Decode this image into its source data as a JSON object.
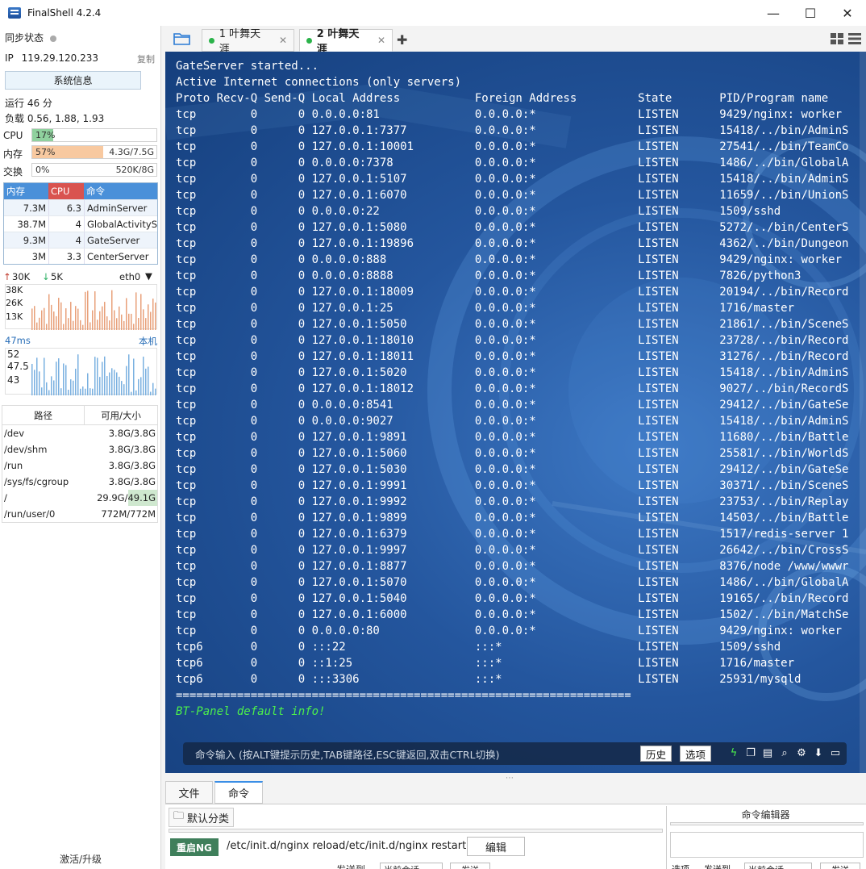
{
  "window": {
    "title": "FinalShell 4.2.4",
    "minimize": "—",
    "maximize": "☐",
    "close": "✕"
  },
  "sidebar": {
    "sync_label": "同步状态",
    "ip_label": "IP",
    "ip": "119.29.120.233",
    "copy": "复制",
    "sysinfo_btn": "系统信息",
    "uptime": "运行 46 分",
    "load": "负载 0.56, 1.88, 1.93",
    "cpu": {
      "label": "CPU",
      "value": "17%",
      "percent": 17
    },
    "mem": {
      "label": "内存",
      "value": "57%",
      "detail": "4.3G/7.5G",
      "percent": 57
    },
    "swap": {
      "label": "交换",
      "value": "0%",
      "detail": "520K/8G",
      "percent": 0
    },
    "proc_headers": [
      "内存",
      "CPU",
      "命令"
    ],
    "processes": [
      {
        "mem": "7.3M",
        "cpu": "6.3",
        "cmd": "AdminServer"
      },
      {
        "mem": "38.7M",
        "cpu": "4",
        "cmd": "GlobalActivityS"
      },
      {
        "mem": "9.3M",
        "cpu": "4",
        "cmd": "GateServer"
      },
      {
        "mem": "3M",
        "cpu": "3.3",
        "cmd": "CenterServer"
      }
    ],
    "net": {
      "up": "30K",
      "down": "5K",
      "iface": "eth0",
      "y_labels": [
        "38K",
        "26K",
        "13K"
      ]
    },
    "ping": {
      "ms": "47ms",
      "host": "本机",
      "y_labels": [
        "52",
        "47.5",
        "43"
      ]
    },
    "disk_headers": [
      "路径",
      "可用/大小"
    ],
    "disks": [
      {
        "path": "/dev",
        "size": "3.8G/3.8G",
        "used": 0
      },
      {
        "path": "/dev/shm",
        "size": "3.8G/3.8G",
        "used": 0
      },
      {
        "path": "/run",
        "size": "3.8G/3.8G",
        "used": 0
      },
      {
        "path": "/sys/fs/cgroup",
        "size": "3.8G/3.8G",
        "used": 0
      },
      {
        "path": "/",
        "size": "29.9G/49.1G",
        "used": 0.4
      },
      {
        "path": "/run/user/0",
        "size": "772M/772M",
        "used": 0
      }
    ],
    "activate": "激活/升级"
  },
  "tabs": [
    {
      "label": "1 叶舞天涯"
    },
    {
      "label": "2 叶舞天涯"
    }
  ],
  "terminal": {
    "lines": [
      "GateServer started...",
      "Active Internet connections (only servers)",
      "Proto Recv-Q Send-Q Local Address           Foreign Address         State       PID/Program name",
      "tcp        0      0 0.0.0.0:81              0.0.0.0:*               LISTEN      9429/nginx: worker",
      "tcp        0      0 127.0.0.1:7377          0.0.0.0:*               LISTEN      15418/../bin/AdminS",
      "tcp        0      0 127.0.0.1:10001         0.0.0.0:*               LISTEN      27541/../bin/TeamCo",
      "tcp        0      0 0.0.0.0:7378            0.0.0.0:*               LISTEN      1486/../bin/GlobalA",
      "tcp        0      0 127.0.0.1:5107          0.0.0.0:*               LISTEN      15418/../bin/AdminS",
      "tcp        0      0 127.0.0.1:6070          0.0.0.0:*               LISTEN      11659/../bin/UnionS",
      "tcp        0      0 0.0.0.0:22              0.0.0.0:*               LISTEN      1509/sshd",
      "tcp        0      0 127.0.0.1:5080          0.0.0.0:*               LISTEN      5272/../bin/CenterS",
      "tcp        0      0 127.0.0.1:19896         0.0.0.0:*               LISTEN      4362/../bin/Dungeon",
      "tcp        0      0 0.0.0.0:888             0.0.0.0:*               LISTEN      9429/nginx: worker",
      "tcp        0      0 0.0.0.0:8888            0.0.0.0:*               LISTEN      7826/python3",
      "tcp        0      0 127.0.0.1:18009         0.0.0.0:*               LISTEN      20194/../bin/Record",
      "tcp        0      0 127.0.0.1:25            0.0.0.0:*               LISTEN      1716/master",
      "tcp        0      0 127.0.0.1:5050          0.0.0.0:*               LISTEN      21861/../bin/SceneS",
      "tcp        0      0 127.0.0.1:18010         0.0.0.0:*               LISTEN      23728/../bin/Record",
      "tcp        0      0 127.0.0.1:18011         0.0.0.0:*               LISTEN      31276/../bin/Record",
      "tcp        0      0 127.0.0.1:5020          0.0.0.0:*               LISTEN      15418/../bin/AdminS",
      "tcp        0      0 127.0.0.1:18012         0.0.0.0:*               LISTEN      9027/../bin/RecordS",
      "tcp        0      0 0.0.0.0:8541            0.0.0.0:*               LISTEN      29412/../bin/GateSe",
      "tcp        0      0 0.0.0.0:9027            0.0.0.0:*               LISTEN      15418/../bin/AdminS",
      "tcp        0      0 127.0.0.1:9891          0.0.0.0:*               LISTEN      11680/../bin/Battle",
      "tcp        0      0 127.0.0.1:5060          0.0.0.0:*               LISTEN      25581/../bin/WorldS",
      "tcp        0      0 127.0.0.1:5030          0.0.0.0:*               LISTEN      29412/../bin/GateSe",
      "tcp        0      0 127.0.0.1:9991          0.0.0.0:*               LISTEN      30371/../bin/SceneS",
      "tcp        0      0 127.0.0.1:9992          0.0.0.0:*               LISTEN      23753/../bin/Replay",
      "tcp        0      0 127.0.0.1:9899          0.0.0.0:*               LISTEN      14503/../bin/Battle",
      "tcp        0      0 127.0.0.1:6379          0.0.0.0:*               LISTEN      1517/redis-server 1",
      "tcp        0      0 127.0.0.1:9997          0.0.0.0:*               LISTEN      26642/../bin/CrossS",
      "tcp        0      0 127.0.0.1:8877          0.0.0.0:*               LISTEN      8376/node /www/wwwr",
      "tcp        0      0 127.0.0.1:5070          0.0.0.0:*               LISTEN      1486/../bin/GlobalA",
      "tcp        0      0 127.0.0.1:5040          0.0.0.0:*               LISTEN      19165/../bin/Record",
      "tcp        0      0 127.0.0.1:6000          0.0.0.0:*               LISTEN      1502/../bin/MatchSe",
      "tcp        0      0 0.0.0.0:80              0.0.0.0:*               LISTEN      9429/nginx: worker",
      "tcp6       0      0 :::22                   :::*                    LISTEN      1509/sshd",
      "tcp6       0      0 ::1:25                  :::*                    LISTEN      1716/master",
      "tcp6       0      0 :::3306                 :::*                    LISTEN      25931/mysqld",
      "==================================================================="
    ],
    "green_line": "BT-Panel default info!",
    "cmd_placeholder": "命令输入 (按ALT键提示历史,TAB键路径,ESC键返回,双击CTRL切换)",
    "history_btn": "历史",
    "options_btn": "选项"
  },
  "bottom": {
    "tabs": [
      "文件",
      "命令"
    ],
    "category": "默认分类",
    "editor_title": "命令编辑器",
    "quick_cmd_name": "重启NG",
    "quick_cmd": "/etc/init.d/nginx reload/etc/init.d/nginx restart",
    "edit_btn": "编辑",
    "send_to": "发送到",
    "current_session": "当前会话",
    "send": "发送",
    "option": "选项"
  },
  "colors": {
    "accent": "#4a90d9",
    "cpu_fill": "#8fd19e",
    "mem_fill": "#f8c9a0",
    "terminal_bg": "#24569e",
    "green_text": "#4cef4c"
  }
}
